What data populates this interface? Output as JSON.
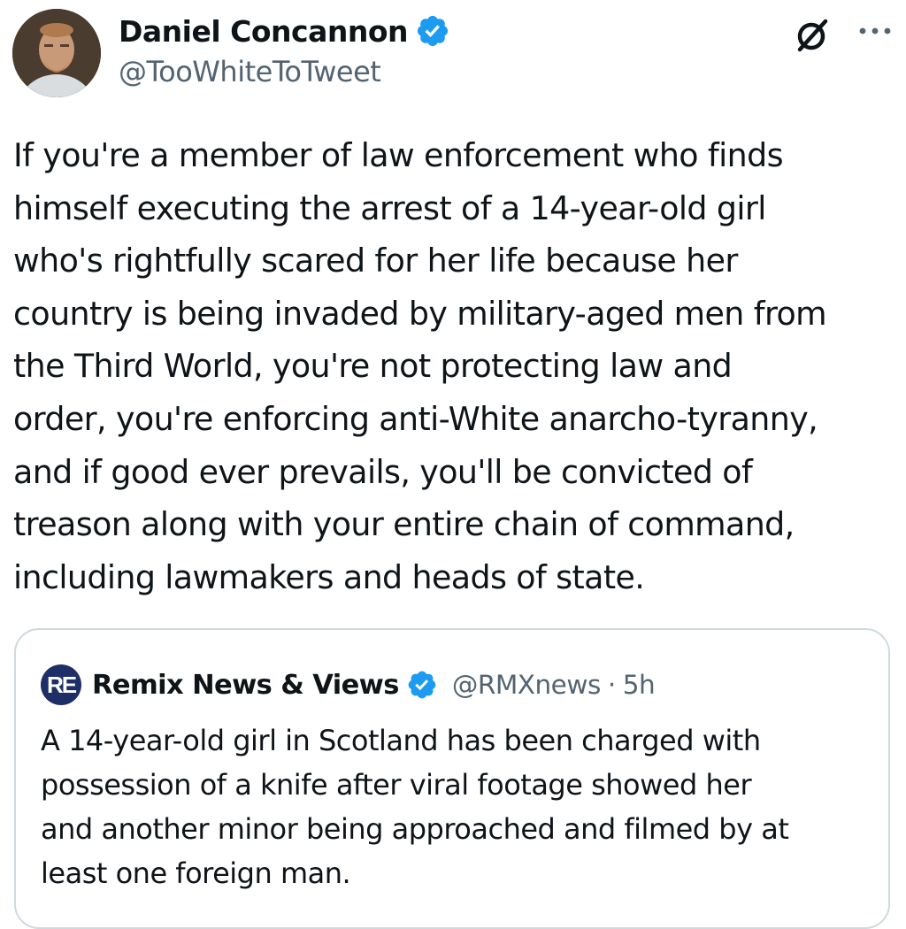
{
  "author": {
    "name": "Daniel Concannon",
    "handle": "@TooWhiteToTweet",
    "verified": true,
    "avatar_icon": "profile-photo"
  },
  "header_actions": {
    "grok_icon": "grok-icon",
    "more_icon": "more-horizontal-icon"
  },
  "tweet": {
    "text": "If you're a member of law enforcement who finds\nhimself executing the arrest of a 14-year-old girl\nwho's rightfully scared for her life because her\ncountry is being invaded by military-aged men from\nthe Third World, you're not protecting law and\norder, you're enforcing anti-White anarcho-tyranny,\nand if good ever prevails, you'll be convicted of\ntreason along with your entire chain of command,\nincluding lawmakers and heads of state."
  },
  "quoted_tweet": {
    "avatar_text": "RE",
    "name": "Remix News & Views",
    "verified": true,
    "handle": "@RMXnews",
    "separator": "·",
    "time": "5h",
    "text": "A 14-year-old girl in Scotland has been charged with\npossession of a knife after viral footage showed her\nand another minor being approached and filmed by at\nleast one foreign man."
  },
  "colors": {
    "text_primary": "#0f1419",
    "text_secondary": "#536471",
    "verified_blue": "#1d9bf0",
    "border": "#cfd9de",
    "quote_avatar_bg": "#1e2f68"
  }
}
